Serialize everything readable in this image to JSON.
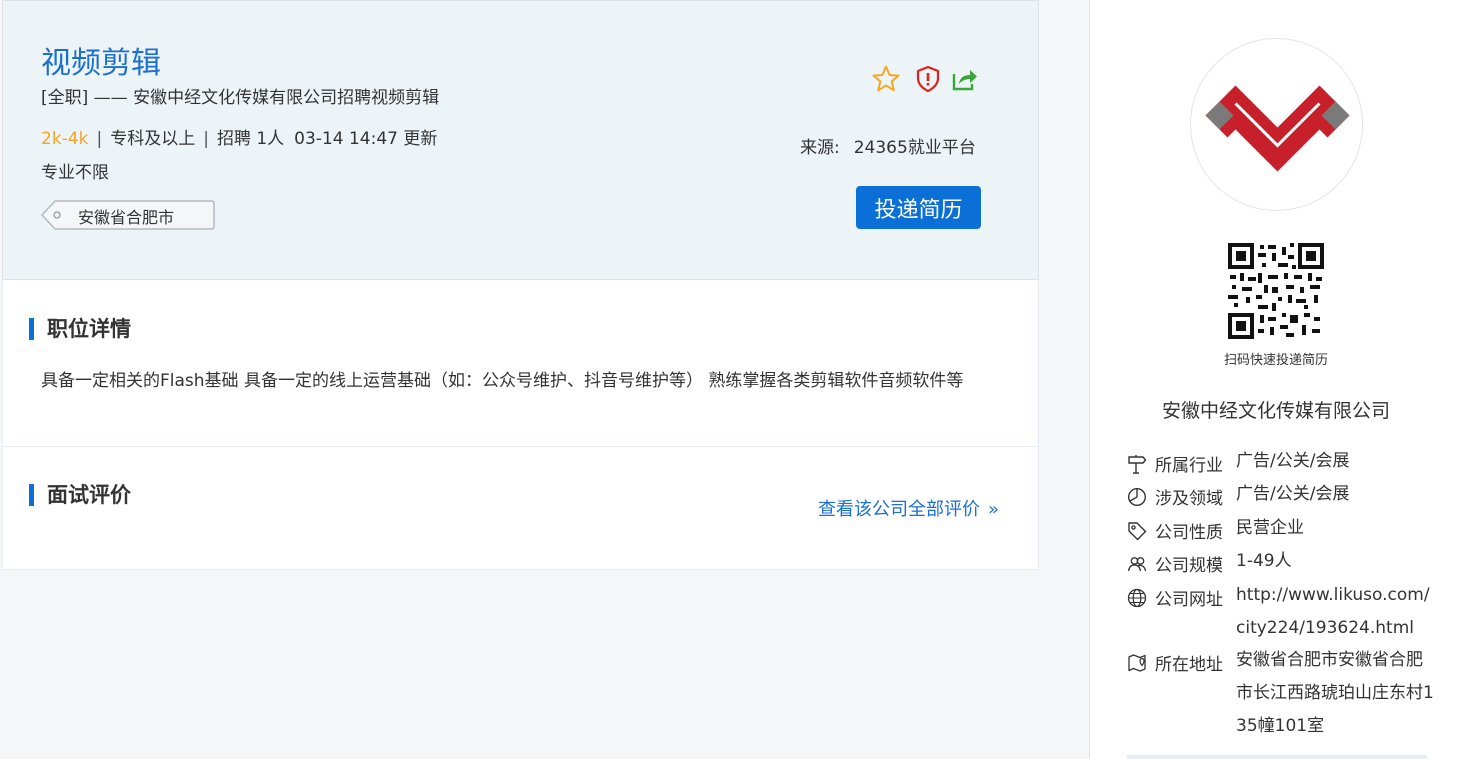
{
  "job": {
    "title": "视频剪辑",
    "subtitle": "[全职]  ——  安徽中经文化传媒有限公司招聘视频剪辑",
    "salary": "2k-4k",
    "sep": "|",
    "education": "专科及以上",
    "hiring": "招聘 1人",
    "updated": "03-14 14:47 更新",
    "major": "专业不限",
    "location_tag": "安徽省合肥市",
    "source_label": "来源:",
    "source_value": "24365就业平台",
    "apply_label": "投递简历"
  },
  "icons": [
    "star-icon",
    "report-icon",
    "share-icon"
  ],
  "details": {
    "title": "职位详情",
    "description": "具备一定相关的Flash基础 具备一定的线上运营基础（如：公众号维护、抖音号维护等） 熟练掌握各类剪辑软件音频软件等"
  },
  "evaluation": {
    "title": "面试评价",
    "link": "查看该公司全部评价",
    "arrow": "»"
  },
  "company": {
    "qr_label": "扫码快速投递简历",
    "name": "安徽中经文化传媒有限公司",
    "rows": [
      {
        "icon": "signpost-icon",
        "label": "所属行业",
        "value": "广告/公关/会展"
      },
      {
        "icon": "pie-chart-icon",
        "label": "涉及领域",
        "value": "广告/公关/会展"
      },
      {
        "icon": "tag-icon",
        "label": "公司性质",
        "value": "民营企业"
      },
      {
        "icon": "people-icon",
        "label": "公司规模",
        "value": "1-49人"
      },
      {
        "icon": "globe-icon",
        "label": "公司网址",
        "value": "http://www.likuso.com/city224/193624.html"
      },
      {
        "icon": "map-pin-icon",
        "label": "所在地址",
        "value": "安徽省合肥市安徽省合肥市长江西路琥珀山庄东村135幢101室"
      }
    ]
  },
  "colors": {
    "accent": "#0a6fd6",
    "salary": "#f5a623",
    "report": "#e02020",
    "share": "#3aa63a",
    "logo_red": "#c8202a",
    "logo_gray": "#7a7a7a"
  }
}
